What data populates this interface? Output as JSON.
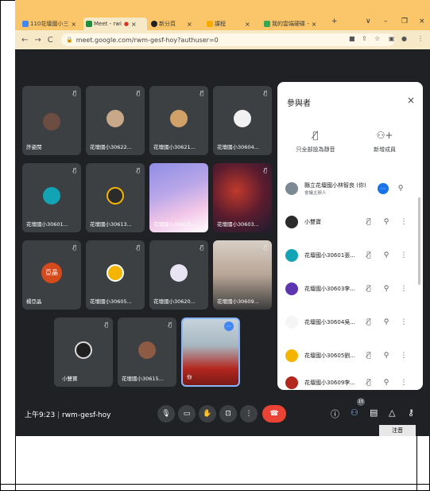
{
  "browser": {
    "tabs": [
      {
        "label": "110花壇國小三",
        "color": "#4285f4"
      },
      {
        "label": "Meet - rwi",
        "color": "#1e8e3e"
      },
      {
        "label": "新分頁",
        "color": "#202124"
      },
      {
        "label": "課程",
        "color": "#f9ab00"
      },
      {
        "label": "我的雲端硬碟 -",
        "color": "#34a853"
      }
    ],
    "url": "meet.google.com/rwm-gesf-hoy?authuser=0"
  },
  "tiles": [
    {
      "name": "許姿閔"
    },
    {
      "name": "花壇國小30622..."
    },
    {
      "name": "花壇國小30621..."
    },
    {
      "name": "花壇國小30604..."
    },
    {
      "name": "花壇國小30601..."
    },
    {
      "name": "花壇國小30613..."
    },
    {
      "name": "花壇國小30619..."
    },
    {
      "name": "花壇國小30603..."
    },
    {
      "name": "楊亞晶",
      "avatar_text": "亞晶"
    },
    {
      "name": "花壇國小30605..."
    },
    {
      "name": "花壇國小30620..."
    },
    {
      "name": "花壇國小30609..."
    },
    {
      "name": "小雙寶"
    },
    {
      "name": "花壇國小30615..."
    },
    {
      "name": "你"
    }
  ],
  "panel": {
    "title": "參與者",
    "mute_all": "只全部設為靜音",
    "add_people": "新增成員",
    "participants": [
      {
        "name": "縣立花壇國小林智良 (你)",
        "role": "會議主辦人"
      },
      {
        "name": "小雙寶"
      },
      {
        "name": "花壇國小30601張..."
      },
      {
        "name": "花壇國小30603李..."
      },
      {
        "name": "花壇國小30604吳..."
      },
      {
        "name": "花壇國小30605劉..."
      },
      {
        "name": "花壇國小30609李..."
      }
    ]
  },
  "bottom": {
    "time": "上午9:23",
    "meeting_code": "rwm-gesf-hoy",
    "participant_count": "15",
    "ime": "注音"
  },
  "colors": {
    "accent": "#1a73e8",
    "end_call": "#ea4335",
    "background": "#202124",
    "tile": "#3c4043"
  }
}
